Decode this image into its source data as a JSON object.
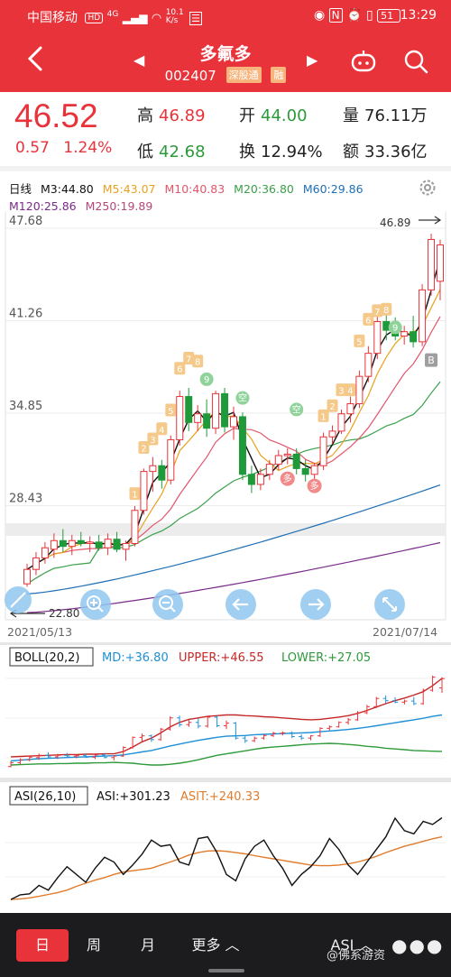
{
  "status_bar": {
    "carrier": "中国移动",
    "hd": "HD",
    "signal": "4G",
    "speed": "10.1\nK/s",
    "battery": "51",
    "time": "13:29"
  },
  "header": {
    "stock_name": "多氟多",
    "stock_code": "002407",
    "tag_connect": "深股通",
    "tag_margin": "融",
    "back_icon": "back-arrow-icon",
    "bg_color": "#e8333a"
  },
  "quote": {
    "last_price": "46.52",
    "change": "0.57",
    "change_pct": "1.24%",
    "high_label": "高",
    "high": "46.89",
    "open_label": "开",
    "open": "44.00",
    "volume_label": "量",
    "volume": "76.11万",
    "low_label": "低",
    "low": "42.68",
    "turnover_label": "换",
    "turnover": "12.94%",
    "amount_label": "额",
    "amount": "33.36亿"
  },
  "main_chart": {
    "period": "日线",
    "ma": [
      {
        "label": "M3:44.80",
        "color": "#111111"
      },
      {
        "label": "M5:43.07",
        "color": "#e8a21d"
      },
      {
        "label": "M10:40.83",
        "color": "#e0566a"
      },
      {
        "label": "M20:36.80",
        "color": "#3aa04a"
      },
      {
        "label": "M60:29.86",
        "color": "#1f6fb5"
      },
      {
        "label": "M120:25.86",
        "color": "#7a2a8a"
      },
      {
        "label": "M250:19.89",
        "color": "#b5477a"
      }
    ],
    "y_ticks": [
      "47.68",
      "41.26",
      "34.85",
      "28.43"
    ],
    "y_tick_values": [
      47.68,
      41.26,
      34.85,
      28.43
    ],
    "y_range": [
      22.01,
      47.68
    ],
    "max_marker": "46.89",
    "min_marker": "22.80",
    "date_start": "2021/05/13",
    "date_end": "2021/07/14",
    "markers": [
      "1",
      "2",
      "3",
      "4",
      "5",
      "6",
      "7",
      "8",
      "9",
      "空",
      "多",
      "多",
      "空",
      "1",
      "2",
      "3",
      "4",
      "5",
      "6",
      "7",
      "8",
      "9",
      "B"
    ],
    "marker_words": {
      "kong": "空",
      "duo": "多",
      "b": "B"
    }
  },
  "chart_data": [
    {
      "type": "candlestick",
      "title": "日线",
      "ylim": [
        22.01,
        47.68
      ],
      "x_range": [
        "2021/05/13",
        "2021/07/14"
      ],
      "candles": [
        {
          "o": 23.0,
          "h": 24.4,
          "l": 22.8,
          "c": 24.0
        },
        {
          "o": 24.0,
          "h": 25.2,
          "l": 23.6,
          "c": 24.8
        },
        {
          "o": 24.8,
          "h": 25.9,
          "l": 24.4,
          "c": 25.5
        },
        {
          "o": 25.4,
          "h": 26.5,
          "l": 24.8,
          "c": 26.0
        },
        {
          "o": 26.0,
          "h": 26.8,
          "l": 25.2,
          "c": 25.6
        },
        {
          "o": 25.6,
          "h": 26.4,
          "l": 25.0,
          "c": 26.0
        },
        {
          "o": 26.0,
          "h": 26.6,
          "l": 25.6,
          "c": 25.8
        },
        {
          "o": 25.8,
          "h": 26.3,
          "l": 25.2,
          "c": 25.9
        },
        {
          "o": 25.9,
          "h": 26.4,
          "l": 25.3,
          "c": 25.5
        },
        {
          "o": 25.5,
          "h": 26.5,
          "l": 25.0,
          "c": 26.1
        },
        {
          "o": 26.1,
          "h": 26.6,
          "l": 25.2,
          "c": 25.4
        },
        {
          "o": 25.4,
          "h": 26.0,
          "l": 24.6,
          "c": 25.8
        },
        {
          "o": 25.8,
          "h": 28.4,
          "l": 25.6,
          "c": 28.1
        },
        {
          "o": 28.1,
          "h": 31.0,
          "l": 27.8,
          "c": 30.8
        },
        {
          "o": 30.8,
          "h": 31.8,
          "l": 29.4,
          "c": 31.2
        },
        {
          "o": 31.2,
          "h": 31.6,
          "l": 29.6,
          "c": 30.2
        },
        {
          "o": 30.2,
          "h": 33.3,
          "l": 29.9,
          "c": 33.0
        },
        {
          "o": 33.0,
          "h": 36.4,
          "l": 32.6,
          "c": 36.0
        },
        {
          "o": 36.0,
          "h": 36.6,
          "l": 33.6,
          "c": 34.2
        },
        {
          "o": 34.2,
          "h": 35.4,
          "l": 33.6,
          "c": 34.8
        },
        {
          "o": 34.8,
          "h": 35.8,
          "l": 33.2,
          "c": 33.8
        },
        {
          "o": 33.8,
          "h": 36.4,
          "l": 33.4,
          "c": 36.2
        },
        {
          "o": 36.2,
          "h": 36.6,
          "l": 33.5,
          "c": 33.9
        },
        {
          "o": 33.9,
          "h": 35.3,
          "l": 33.0,
          "c": 34.6
        },
        {
          "o": 34.6,
          "h": 34.9,
          "l": 30.2,
          "c": 30.6
        },
        {
          "o": 30.6,
          "h": 31.2,
          "l": 29.3,
          "c": 29.9
        },
        {
          "o": 29.9,
          "h": 31.0,
          "l": 29.5,
          "c": 30.6
        },
        {
          "o": 30.6,
          "h": 31.6,
          "l": 30.2,
          "c": 31.3
        },
        {
          "o": 31.3,
          "h": 32.3,
          "l": 30.9,
          "c": 31.9
        },
        {
          "o": 31.9,
          "h": 32.4,
          "l": 31.3,
          "c": 32.0
        },
        {
          "o": 32.0,
          "h": 32.4,
          "l": 30.6,
          "c": 31.0
        },
        {
          "o": 31.0,
          "h": 31.6,
          "l": 30.1,
          "c": 30.6
        },
        {
          "o": 30.6,
          "h": 31.4,
          "l": 30.0,
          "c": 31.2
        },
        {
          "o": 31.2,
          "h": 33.5,
          "l": 30.9,
          "c": 33.2
        },
        {
          "o": 33.2,
          "h": 34.0,
          "l": 32.7,
          "c": 33.6
        },
        {
          "o": 33.6,
          "h": 35.1,
          "l": 33.4,
          "c": 34.8
        },
        {
          "o": 34.8,
          "h": 36.0,
          "l": 34.2,
          "c": 35.5
        },
        {
          "o": 35.5,
          "h": 37.8,
          "l": 35.2,
          "c": 37.4
        },
        {
          "o": 37.4,
          "h": 39.5,
          "l": 37.0,
          "c": 39.0
        },
        {
          "o": 39.0,
          "h": 41.6,
          "l": 38.6,
          "c": 41.2
        },
        {
          "o": 41.2,
          "h": 42.0,
          "l": 39.9,
          "c": 40.6
        },
        {
          "o": 40.6,
          "h": 41.5,
          "l": 39.9,
          "c": 40.2
        },
        {
          "o": 40.2,
          "h": 40.9,
          "l": 39.6,
          "c": 40.5
        },
        {
          "o": 40.5,
          "h": 41.6,
          "l": 39.4,
          "c": 39.8
        },
        {
          "o": 39.8,
          "h": 43.8,
          "l": 39.5,
          "c": 43.4
        },
        {
          "o": 43.4,
          "h": 47.3,
          "l": 43.0,
          "c": 46.9
        },
        {
          "o": 44.0,
          "h": 46.89,
          "l": 42.68,
          "c": 46.52
        }
      ]
    },
    {
      "type": "line",
      "title": "BOLL(20,2)",
      "series": [
        {
          "name": "MD",
          "label": "MD:+36.80",
          "color": "#1e90d6",
          "values": [
            24.5,
            24.7,
            24.9,
            25.1,
            25.2,
            25.3,
            25.4,
            25.5,
            25.6,
            25.7,
            25.8,
            25.9,
            26.1,
            26.5,
            26.9,
            27.3,
            27.9,
            28.5,
            29.0,
            29.5,
            30.0,
            30.4,
            30.8,
            31.1,
            31.2,
            31.3,
            31.5,
            31.6,
            31.7,
            31.8,
            31.9,
            32.0,
            32.1,
            32.3,
            32.5,
            32.7,
            32.9,
            33.2,
            33.5,
            33.9,
            34.3,
            34.7,
            35.1,
            35.5,
            35.9,
            36.4,
            36.8
          ]
        },
        {
          "name": "UPPER",
          "label": "UPPER:+46.55",
          "color": "#c62828",
          "values": [
            25.6,
            25.7,
            25.8,
            25.9,
            26.0,
            26.1,
            26.2,
            26.2,
            26.3,
            26.3,
            26.4,
            26.4,
            27.0,
            28.2,
            29.6,
            30.6,
            32.0,
            33.6,
            34.8,
            35.6,
            36.0,
            36.4,
            36.6,
            36.8,
            36.8,
            36.6,
            36.5,
            36.3,
            36.2,
            36.0,
            35.8,
            35.6,
            35.5,
            35.6,
            35.9,
            36.2,
            36.6,
            37.2,
            38.0,
            38.9,
            39.8,
            40.6,
            41.3,
            42.1,
            43.0,
            44.6,
            46.55
          ]
        },
        {
          "name": "LOWER",
          "label": "LOWER:+27.05",
          "color": "#2e9a3a",
          "values": [
            23.4,
            23.5,
            23.6,
            23.7,
            23.7,
            23.8,
            23.8,
            23.9,
            23.9,
            24.0,
            24.0,
            24.1,
            24.0,
            23.9,
            23.6,
            23.4,
            23.4,
            23.6,
            23.9,
            24.3,
            24.8,
            25.4,
            26.0,
            26.4,
            26.8,
            27.2,
            27.6,
            28.0,
            28.2,
            28.4,
            28.6,
            28.8,
            29.0,
            29.1,
            29.2,
            29.1,
            28.9,
            28.7,
            28.4,
            28.2,
            27.9,
            27.7,
            27.5,
            27.3,
            27.2,
            27.1,
            27.05
          ]
        }
      ]
    },
    {
      "type": "line",
      "title": "ASI(26,10)",
      "series": [
        {
          "name": "ASI",
          "label": "ASI:+301.23",
          "color": "#111111",
          "values": [
            40,
            55,
            58,
            85,
            70,
            110,
            145,
            120,
            95,
            140,
            175,
            160,
            120,
            150,
            185,
            230,
            210,
            215,
            160,
            150,
            235,
            240,
            190,
            120,
            100,
            170,
            210,
            230,
            180,
            140,
            85,
            120,
            145,
            180,
            235,
            200,
            150,
            120,
            160,
            200,
            240,
            300,
            260,
            250,
            290,
            280,
            301.23
          ]
        },
        {
          "name": "ASIT",
          "label": "ASIT:+240.33",
          "color": "#e07b2b",
          "values": [
            40,
            42,
            45,
            50,
            56,
            62,
            70,
            82,
            92,
            102,
            110,
            120,
            128,
            132,
            136,
            140,
            150,
            160,
            170,
            182,
            190,
            195,
            196,
            194,
            190,
            186,
            180,
            175,
            170,
            165,
            160,
            155,
            150,
            148,
            148,
            150,
            154,
            160,
            168,
            178,
            190,
            200,
            210,
            218,
            226,
            234,
            240.33
          ]
        }
      ]
    }
  ],
  "boll": {
    "title": "BOLL(20,2)",
    "md": "MD:+36.80",
    "upper": "UPPER:+46.55",
    "lower": "LOWER:+27.05"
  },
  "asi": {
    "title": "ASI(26,10)",
    "asi": "ASI:+301.23",
    "asit": "ASIT:+240.33"
  },
  "bottom_tabs": {
    "day": "日",
    "week": "周",
    "month": "月",
    "more": "更多 ︿",
    "indicator": "ASI ︿",
    "dots": "●●●"
  },
  "watermark": "@佛系游资"
}
